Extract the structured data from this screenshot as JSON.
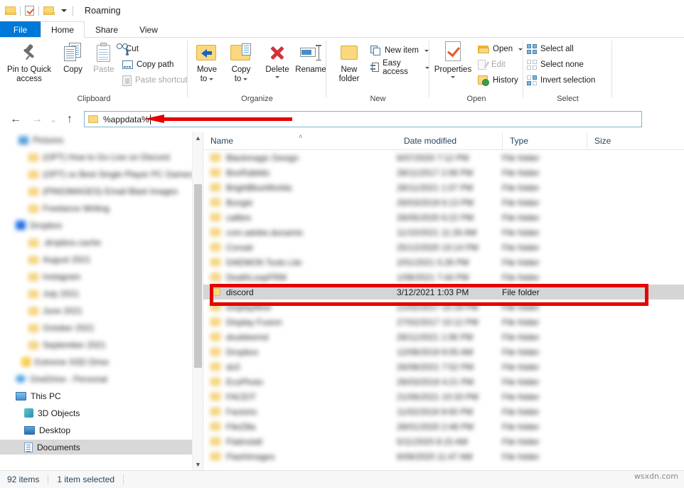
{
  "window": {
    "title": "Roaming",
    "qat": [
      {
        "name": "folder-icon",
        "label": "Folder"
      },
      {
        "name": "properties-icon",
        "label": "Properties"
      },
      {
        "name": "new-folder-icon",
        "label": "New folder"
      },
      {
        "name": "customize-quick-access-toolbar-caret",
        "label": "Customize Quick Access Toolbar"
      }
    ]
  },
  "tabs": [
    {
      "label": "File",
      "active": false,
      "accent": "#0078d7"
    },
    {
      "label": "Home",
      "active": true
    },
    {
      "label": "Share",
      "active": false
    },
    {
      "label": "View",
      "active": false
    }
  ],
  "ribbon": {
    "groups": [
      {
        "label": "Clipboard",
        "big_buttons": [
          {
            "label_line1": "Pin to Quick",
            "label_line2": "access",
            "icon": "pin-icon",
            "disabled": false
          },
          {
            "label_line1": "Copy",
            "label_line2": "",
            "icon": "copy-icon",
            "disabled": false
          },
          {
            "label_line1": "Paste",
            "label_line2": "",
            "icon": "paste-icon",
            "disabled": true
          }
        ],
        "small_buttons": [
          {
            "label": "Cut",
            "icon": "scissors-icon",
            "disabled": false
          },
          {
            "label": "Copy path",
            "icon": "copy-path-icon",
            "disabled": false
          },
          {
            "label": "Paste shortcut",
            "icon": "paste-shortcut-icon",
            "disabled": true
          }
        ]
      },
      {
        "label": "Organize",
        "big_buttons": [
          {
            "label_line1": "Move",
            "label_line2": "to",
            "icon": "move-to-icon",
            "has_caret": true
          },
          {
            "label_line1": "Copy",
            "label_line2": "to",
            "icon": "copy-to-icon",
            "has_caret": true
          },
          {
            "label_line1": "Delete",
            "label_line2": "",
            "icon": "delete-icon",
            "has_caret": true
          },
          {
            "label_line1": "Rename",
            "label_line2": "",
            "icon": "rename-icon",
            "has_caret": false
          }
        ]
      },
      {
        "label": "New",
        "big_buttons": [
          {
            "label_line1": "New",
            "label_line2": "folder",
            "icon": "new-folder-icon"
          }
        ],
        "small_buttons": [
          {
            "label": "New item",
            "icon": "new-item-icon",
            "has_caret": true
          },
          {
            "label": "Easy access",
            "icon": "easy-access-icon",
            "has_caret": true
          }
        ]
      },
      {
        "label": "Open",
        "big_buttons": [
          {
            "label_line1": "Properties",
            "label_line2": "",
            "icon": "properties-icon",
            "has_caret": true
          }
        ],
        "small_buttons": [
          {
            "label": "Open",
            "icon": "open-folder-icon",
            "has_caret": true,
            "disabled": false
          },
          {
            "label": "Edit",
            "icon": "edit-icon",
            "disabled": true
          },
          {
            "label": "History",
            "icon": "history-icon",
            "disabled": false
          }
        ]
      },
      {
        "label": "Select",
        "small_buttons": [
          {
            "label": "Select all",
            "icon": "select-all-icon"
          },
          {
            "label": "Select none",
            "icon": "select-none-icon"
          },
          {
            "label": "Invert selection",
            "icon": "invert-selection-icon"
          }
        ]
      }
    ]
  },
  "navigation": {
    "back": "←",
    "forward": "→",
    "recent": "⌄",
    "up": "↑",
    "address_value": "%appdata%",
    "address_placeholder": "%appdata%"
  },
  "annotations": {
    "arrow_color": "#e60000",
    "rect_color": "#e60000"
  },
  "sidebar": {
    "items": [
      {
        "label": "Pictures",
        "icon": "pictures-icon",
        "indent": 26,
        "blurred": true
      },
      {
        "label": "(OPT) How to Go Live on Discord",
        "icon": "folder-icon",
        "indent": 40,
        "blurred": true
      },
      {
        "label": "(OPT) xx Best Single Player PC Games for",
        "icon": "folder-icon",
        "indent": 40,
        "blurred": true
      },
      {
        "label": "(PINGIMAGES) Email Blast Images",
        "icon": "folder-icon",
        "indent": 40,
        "blurred": true
      },
      {
        "label": "Freelance Writing",
        "icon": "folder-icon",
        "indent": 40,
        "blurred": true
      },
      {
        "label": "Dropbox",
        "icon": "dropbox-icon",
        "indent": 22,
        "blurred": true
      },
      {
        "label": ".dropbox.cache",
        "icon": "folder-icon",
        "indent": 40,
        "blurred": true
      },
      {
        "label": "August 2021",
        "icon": "folder-icon",
        "indent": 40,
        "blurred": true
      },
      {
        "label": "Instagram",
        "icon": "folder-icon",
        "indent": 40,
        "blurred": true
      },
      {
        "label": "July 2021",
        "icon": "folder-icon",
        "indent": 40,
        "blurred": true
      },
      {
        "label": "June 2021",
        "icon": "folder-icon",
        "indent": 40,
        "blurred": true
      },
      {
        "label": "October 2021",
        "icon": "folder-icon",
        "indent": 40,
        "blurred": true
      },
      {
        "label": "September 2021",
        "icon": "folder-icon",
        "indent": 40,
        "blurred": true
      },
      {
        "label": "Extreme SSD Drive",
        "icon": "drive-icon",
        "indent": 30,
        "blurred": true
      },
      {
        "label": "OneDrive - Personal",
        "icon": "onedrive-icon",
        "indent": 22,
        "blurred": true
      },
      {
        "label": "This PC",
        "icon": "this-pc-icon",
        "indent": 22,
        "blurred": false
      },
      {
        "label": "3D Objects",
        "icon": "3d-objects-icon",
        "indent": 34,
        "blurred": false
      },
      {
        "label": "Desktop",
        "icon": "desktop-icon",
        "indent": 34,
        "blurred": false
      },
      {
        "label": "Documents",
        "icon": "documents-icon",
        "indent": 34,
        "blurred": false,
        "selected": true
      }
    ]
  },
  "file_list": {
    "columns": [
      {
        "label": "Name",
        "sorted": true,
        "sort_indicator": "˄"
      },
      {
        "label": "Date modified"
      },
      {
        "label": "Type"
      },
      {
        "label": "Size"
      }
    ],
    "rows": [
      {
        "name": "Blackmagic Design",
        "date": "6/07/2020 7:12 PM",
        "type": "File folder",
        "size": "",
        "blurred": true
      },
      {
        "name": "BoxRabbits",
        "date": "28/11/2017 2:08 PM",
        "type": "File folder",
        "size": "",
        "blurred": true
      },
      {
        "name": "BrightBlueWorlds",
        "date": "28/11/2021 1:07 PM",
        "type": "File folder",
        "size": "",
        "blurred": true
      },
      {
        "name": "Bungie",
        "date": "26/03/2019 6:13 PM",
        "type": "File folder",
        "size": "",
        "blurred": true
      },
      {
        "name": "calibre",
        "date": "26/05/2020 6:22 PM",
        "type": "File folder",
        "size": "",
        "blurred": true
      },
      {
        "name": "com.adobe.dunamis",
        "date": "11/10/2021 11:26 AM",
        "type": "File folder",
        "size": "",
        "blurred": true
      },
      {
        "name": "Corsair",
        "date": "25/12/2020 10:14 PM",
        "type": "File folder",
        "size": "",
        "blurred": true
      },
      {
        "name": "DAEMON Tools Lite",
        "date": "2/01/2021 5:26 PM",
        "type": "File folder",
        "size": "",
        "blurred": true
      },
      {
        "name": "DeathLoopFRM",
        "date": "1/08/2021 7:44 PM",
        "type": "File folder",
        "size": "",
        "blurred": true
      },
      {
        "name": "discord",
        "date": "3/12/2021 1:03 PM",
        "type": "File folder",
        "size": "",
        "blurred": false,
        "selected": true,
        "highlighted": true
      },
      {
        "name": "DisplayMod",
        "date": "21/02/2017 10:19 PM",
        "type": "File folder",
        "size": "",
        "blurred": true
      },
      {
        "name": "Display Fusion",
        "date": "27/02/2017 10:12 PM",
        "type": "File folder",
        "size": "",
        "blurred": true
      },
      {
        "name": "doubleemd",
        "date": "28/11/2021 1:06 PM",
        "type": "File folder",
        "size": "",
        "blurred": true
      },
      {
        "name": "Dropbox",
        "date": "12/08/2019 9:05 AM",
        "type": "File folder",
        "size": "",
        "blurred": true
      },
      {
        "name": "ds3",
        "date": "26/08/2021 7:52 PM",
        "type": "File folder",
        "size": "",
        "blurred": true
      },
      {
        "name": "EcoPhoto",
        "date": "26/03/2019 4:21 PM",
        "type": "File folder",
        "size": "",
        "blurred": true
      },
      {
        "name": "FACEIT",
        "date": "21/06/2021 10:33 PM",
        "type": "File folder",
        "size": "",
        "blurred": true
      },
      {
        "name": "Factorio",
        "date": "11/02/2019 9:00 PM",
        "type": "File folder",
        "size": "",
        "blurred": true
      },
      {
        "name": "FileZilla",
        "date": "28/01/2020 2:48 PM",
        "type": "File folder",
        "size": "",
        "blurred": true
      },
      {
        "name": "Flatinstall",
        "date": "5/11/2020 8:15 AM",
        "type": "File folder",
        "size": "",
        "blurred": true
      },
      {
        "name": "FlashImages",
        "date": "6/09/2020 11:47 AM",
        "type": "File folder",
        "size": "",
        "blurred": true
      }
    ]
  },
  "status_bar": {
    "item_count": "92 items",
    "selection": "1 item selected"
  },
  "watermark": {
    "text": "wsxdn.com"
  }
}
